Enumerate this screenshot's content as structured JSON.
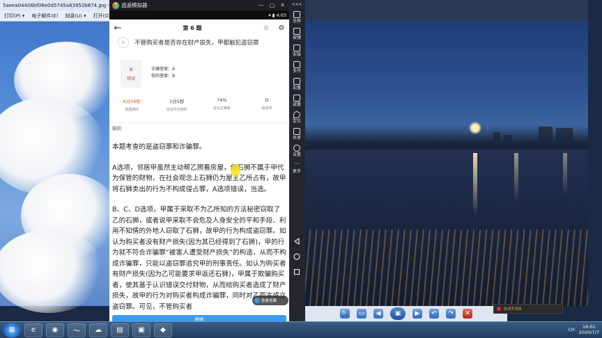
{
  "desktop": {
    "viewer_title": "5aeea04406bf06e0d5745a83952b874.jpg - Windows 照",
    "viewer_menu": [
      "打印(P) ▾",
      "电子邮件(E)",
      "刻录(U) ▾",
      "打开(O)"
    ]
  },
  "emulator": {
    "app_name": "逍遥模拟器",
    "status_time": "4:03",
    "status_icons": "▾ ▮",
    "window_buttons": [
      "—",
      "▢",
      "✕"
    ],
    "side_toolbar": [
      {
        "label": "全屏",
        "icon": "fullscreen-icon"
      },
      {
        "label": "按键",
        "icon": "keyboard-icon"
      },
      {
        "label": "安装",
        "icon": "apk-install-icon"
      },
      {
        "label": "多开",
        "icon": "multi-instance-icon"
      },
      {
        "label": "加量",
        "icon": "volume-up-icon"
      },
      {
        "label": "减量",
        "icon": "volume-down-icon"
      },
      {
        "label": "定位",
        "icon": "location-icon"
      },
      {
        "label": "共享",
        "icon": "share-folder-icon"
      },
      {
        "label": "设置",
        "icon": "settings-gear-icon"
      },
      {
        "label": "更多",
        "icon": "more-icon"
      }
    ],
    "collapse_glyph": "<<<"
  },
  "phone": {
    "header_title": "第 6 题",
    "back_glyph": "←",
    "star_glyph": "☆",
    "settings_glyph": "⚙",
    "option_d_letter": "D",
    "option_d_text": "不管购买者是否存在财产损失，甲都触犯盗窃罪",
    "result_label": "错误",
    "result_glyph": "✕",
    "correct_answer": "正确答案：A",
    "your_answer": "你的答案：B",
    "stats": [
      {
        "value": "6分58秒",
        "label": "答题用时",
        "red": true
      },
      {
        "value": "1分5秒",
        "label": "全站平均用时",
        "red": false
      },
      {
        "value": "74%",
        "label": "全站正确率",
        "red": false
      },
      {
        "value": "D",
        "label": "易错项",
        "red": false
      }
    ],
    "analysis_heading": "解析",
    "analysis_paragraphs": [
      "本题考查的是盗窃罪和诈骗罪。",
      "A选项，邻居甲虽然主动帮乙照看房屋，但石狮不属于甲代为保管的财物，在社会观念上石狮仍为屋主乙所占有，故甲将石狮卖出的行为不构成侵占罪，A选项错误，当选。",
      "B、C、D选项，甲属于采取不为乙所知的方法秘密窃取了乙的石狮，或者说甲采取不会危及人身安全的平和手段、利用不知情的外地人窃取了石狮，故甲的行为构成盗窃罪。如认为购买者没有财产损失(因为其已经得到了石狮)，甲的行为就不符合诈骗罪“被害人遭受财产损失”的构造，从而不构成诈骗罪，只能以盗窃罪追究甲的刑事责任。如认为购买者有财产损失(因为乙可能要求甲返还石狮)，甲属于欺骗购买者，使其基于认识错误交付财物，从而给购买者造成了财产损失，故甲的行为对购买者构成诈骗罪，同时对乙而言成立盗窃罪。可见，不管购买者"
    ],
    "float_chip": "查看答案",
    "bottom_button": "继续"
  },
  "viewer_controls": {
    "buttons": [
      "🔍",
      "▭",
      "◀",
      "▣",
      "▶",
      "↶",
      "↷",
      "✕"
    ]
  },
  "recorder": {
    "time": "0:07:03"
  },
  "taskbar": {
    "start_glyph": "⊞",
    "apps": [
      "e",
      "◉",
      "〜",
      "☁",
      "▤",
      "▣",
      "◆"
    ],
    "clock_time": "16:01",
    "clock_date": "2020/7/7",
    "lang": "CH"
  }
}
